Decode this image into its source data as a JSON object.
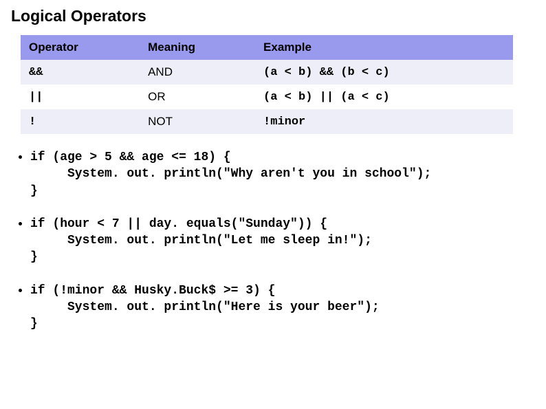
{
  "title": "Logical Operators",
  "table": {
    "headers": [
      "Operator",
      "Meaning",
      "Example"
    ],
    "rows": [
      {
        "operator": "&&",
        "meaning": "AND",
        "example": "(a < b) && (b < c)"
      },
      {
        "operator": "||",
        "meaning": "OR",
        "example": "(a < b) || (a < c)"
      },
      {
        "operator": "!",
        "meaning": "NOT",
        "example": "!minor"
      }
    ]
  },
  "examples": [
    "if (age > 5 && age <= 18) {\n     System. out. println(\"Why aren't you in school\");\n}",
    "if (hour < 7 || day. equals(\"Sunday\")) {\n     System. out. println(\"Let me sleep in!\");\n}",
    "if (!minor && Husky.Buck$ >= 3) {\n     System. out. println(\"Here is your beer\");\n}"
  ]
}
